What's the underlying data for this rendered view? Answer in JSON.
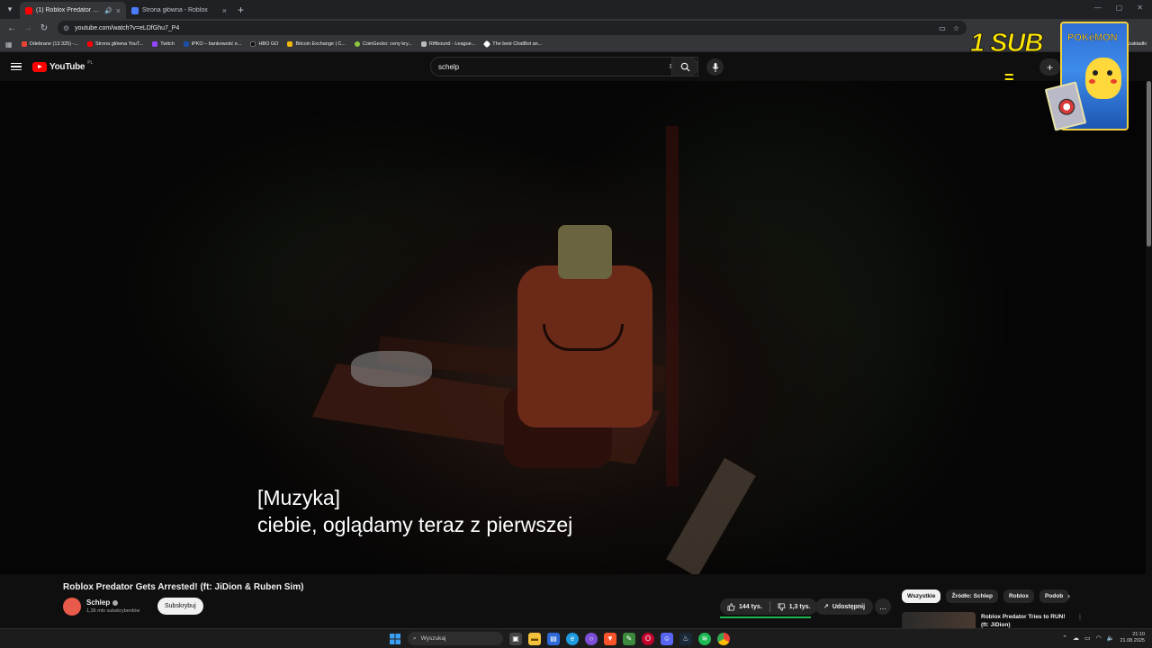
{
  "browser": {
    "tabs": [
      {
        "title": "(1) Roblox Predator Gets Ar...",
        "active": true,
        "favicon_color": "#ff0000"
      },
      {
        "title": "Strona główna - Roblox",
        "active": false,
        "favicon_color": "#4a7cff"
      }
    ],
    "url": "youtube.com/watch?v=eLDfGhu7_P4",
    "bookmarks": [
      {
        "label": "Odebrane (13 325) -...",
        "color": "#ea4335"
      },
      {
        "label": "Strona główna YouT...",
        "color": "#ff0000"
      },
      {
        "label": "Twitch",
        "color": "#9146ff"
      },
      {
        "label": "iPKO – bankowość e...",
        "color": "#1a4fa3"
      },
      {
        "label": "HBO GO",
        "color": "#111111"
      },
      {
        "label": "Bitcoin Exchange | C...",
        "color": "#f0b90b"
      },
      {
        "label": "CoinGecko: ceny kry...",
        "color": "#8dc63f"
      },
      {
        "label": "Riftbound - League...",
        "color": "#bbbbbb"
      },
      {
        "label": "The best ChatBot an...",
        "color": "#ffffff"
      }
    ],
    "bookmarks_right": "Wszystkie zakładki"
  },
  "youtube": {
    "logo_text": "YouTube",
    "region": "PL",
    "search_value": "schelp",
    "create_label": "+"
  },
  "video": {
    "caption_lines": [
      "[Muzyka]",
      "ciebie, oglądamy teraz z pierwszej"
    ]
  },
  "overlay": {
    "promo_text": "1 SUB",
    "promo_eq": "=",
    "pack_logo": "POKéMON"
  },
  "watch": {
    "title": "Roblox Predator Gets Arrested! (ft: JiDion & Ruben Sim)",
    "channel_name": "Schlep",
    "channel_subs": "1,36 mln subskrybentów",
    "subscribe_label": "Subskrybuj",
    "likes": "144 tys.",
    "dislikes": "1,3 tys.",
    "like_ratio": 0.99,
    "share_label": "Udostępnij",
    "more_label": "...",
    "chips": [
      {
        "label": "Wszystkie",
        "selected": true
      },
      {
        "label": "Źródło: Schlep",
        "selected": false
      },
      {
        "label": "Roblox",
        "selected": false
      },
      {
        "label": "Podob",
        "selected": false
      }
    ],
    "recommended_title": "Roblox Predator Tries to RUN! (ft: JiDion)"
  },
  "taskbar": {
    "search_placeholder": "Wyszukaj",
    "time": "21:10",
    "date": "21.08.2025"
  }
}
